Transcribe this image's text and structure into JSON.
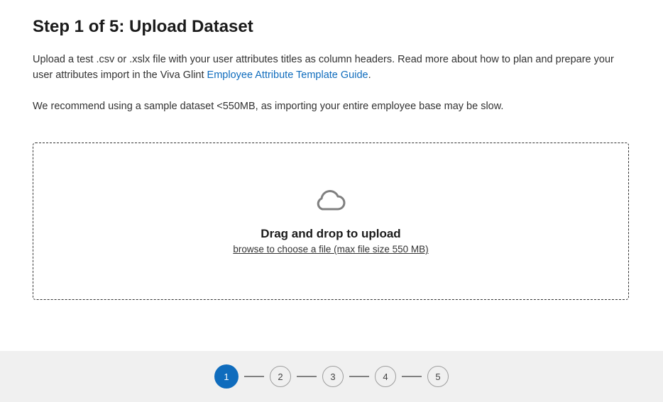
{
  "header": {
    "title": "Step 1 of 5: Upload Dataset"
  },
  "intro": {
    "textBefore": "Upload a test .csv or .xslx file with your user attributes titles as column headers. Read more about how to plan and prepare your user attributes import in the Viva Glint ",
    "linkText": "Employee Attribute Template Guide",
    "textAfter": "."
  },
  "recommend": "We recommend using a sample dataset <550MB, as importing your entire employee base may be slow.",
  "dropzone": {
    "title": "Drag and drop to upload",
    "subtext": "browse to choose a file (max file size 550 MB)"
  },
  "stepper": {
    "current": 1,
    "steps": [
      "1",
      "2",
      "3",
      "4",
      "5"
    ]
  }
}
